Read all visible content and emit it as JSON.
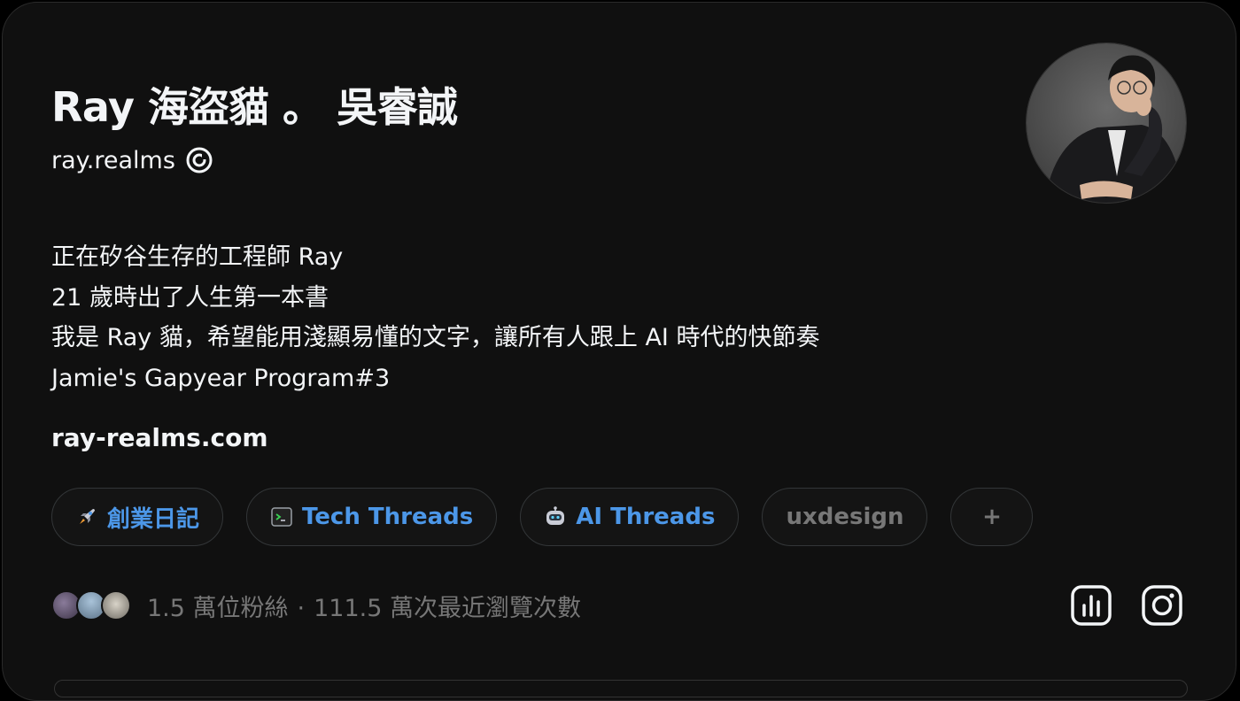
{
  "profile": {
    "display_name": "Ray 海盜貓 。 吳睿誠",
    "handle": "ray.realms",
    "bio_lines": [
      "正在矽谷生存的工程師 Ray",
      "21 歲時出了人生第一本書",
      "我是 Ray 貓，希望能用淺顯易懂的文字，讓所有人跟上 AI 時代的快節奏",
      "Jamie's Gapyear Program#3"
    ],
    "website": "ray-realms.com"
  },
  "tags": [
    {
      "label": "創業日記",
      "icon": "rocket-icon"
    },
    {
      "label": "Tech Threads",
      "icon": "terminal-icon"
    },
    {
      "label": "AI Threads",
      "icon": "robot-icon"
    },
    {
      "label": "uxdesign",
      "icon": ""
    },
    {
      "label": "+",
      "icon": ""
    }
  ],
  "stats": {
    "followers": "1.5 萬位粉絲",
    "separator": "·",
    "views": "111.5 萬次最近瀏覽次數"
  },
  "colors": {
    "background": "#101010",
    "text_primary": "#f3f5f7",
    "text_secondary": "#777777",
    "accent": "#4c97e8"
  }
}
